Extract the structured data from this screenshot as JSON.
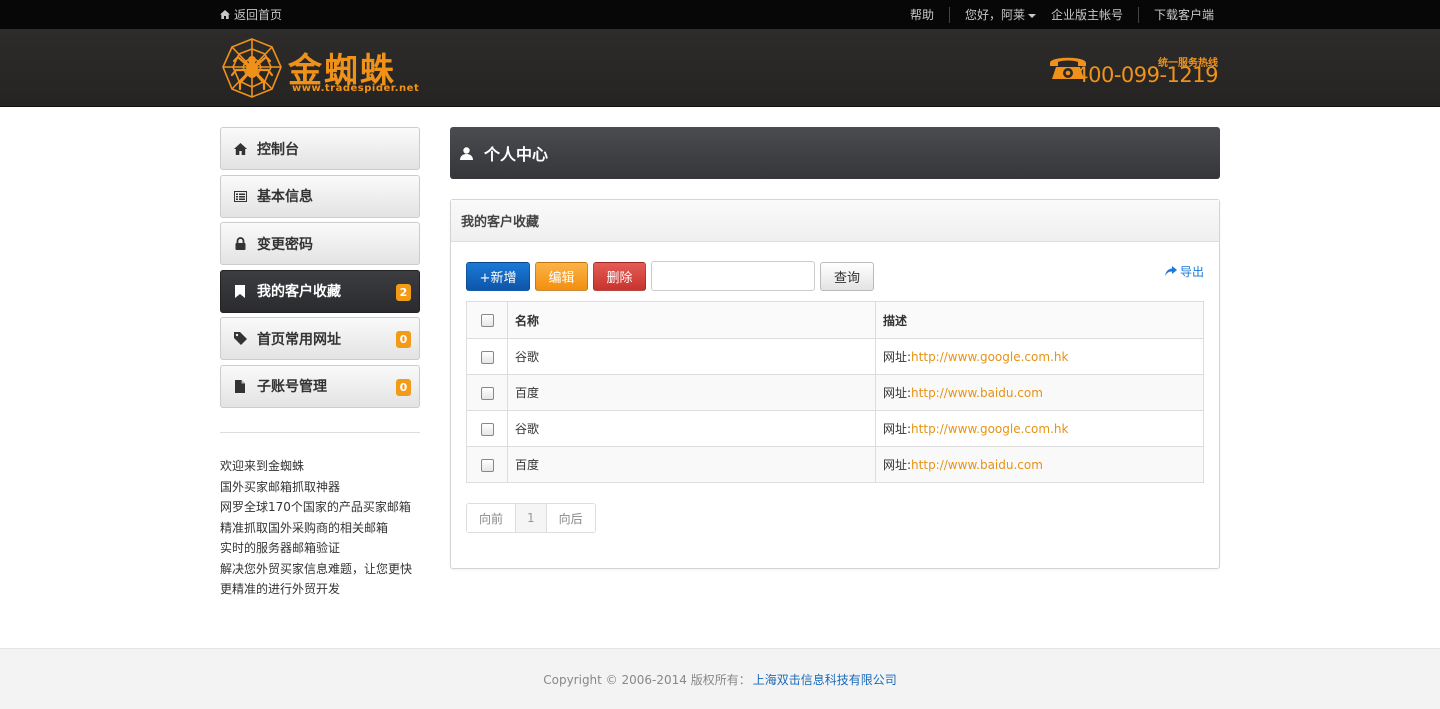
{
  "topbar": {
    "back_label": "返回首页",
    "help": "帮助",
    "greeting": "您好，阿莱",
    "account": "企业版主帐号",
    "download": "下载客户端"
  },
  "header": {
    "logo_text": "金蜘蛛",
    "logo_url": "www.tradespider.net",
    "hotline_label": "统一服务热线",
    "hotline_number": "400-099-1219"
  },
  "sidebar": {
    "items": [
      {
        "label": "控制台",
        "icon": "home-icon"
      },
      {
        "label": "基本信息",
        "icon": "list-icon"
      },
      {
        "label": "变更密码",
        "icon": "lock-icon"
      },
      {
        "label": "我的客户收藏",
        "icon": "bookmark-icon",
        "badge": "2",
        "active": true
      },
      {
        "label": "首页常用网址",
        "icon": "tag-icon",
        "badge": "0"
      },
      {
        "label": "子账号管理",
        "icon": "file-icon",
        "badge": "0"
      }
    ],
    "promo_lines": [
      "欢迎来到金蜘蛛",
      "国外买家邮箱抓取神器",
      "网罗全球170个国家的产品买家邮箱",
      "精准抓取国外采购商的相关邮箱",
      "实时的服务器邮箱验证",
      "解决您外贸买家信息难题，让您更快",
      "更精准的进行外贸开发"
    ]
  },
  "main": {
    "page_title": "个人中心",
    "panel_title": "我的客户收藏",
    "toolbar": {
      "add_label": "+新增",
      "edit_label": "编辑",
      "delete_label": "删除",
      "search_value": "",
      "query_label": "查询",
      "export_label": "导出"
    },
    "table": {
      "columns": [
        "名称",
        "描述"
      ],
      "desc_prefix": "网址:",
      "rows": [
        {
          "name": "谷歌",
          "url": "http://www.google.com.hk"
        },
        {
          "name": "百度",
          "url": "http://www.baidu.com"
        },
        {
          "name": "谷歌",
          "url": "http://www.google.com.hk"
        },
        {
          "name": "百度",
          "url": "http://www.baidu.com"
        }
      ]
    },
    "pager": {
      "prev": "向前",
      "page": "1",
      "next": "向后"
    }
  },
  "footer": {
    "copyright": "Copyright © 2006-2014 版权所有：",
    "company": "上海双击信息科技有限公司"
  },
  "colors": {
    "accent_orange": "#f0921a",
    "primary_blue": "#1a7ad8",
    "dark_bar": "#35363a",
    "link_orange": "#e59317"
  }
}
